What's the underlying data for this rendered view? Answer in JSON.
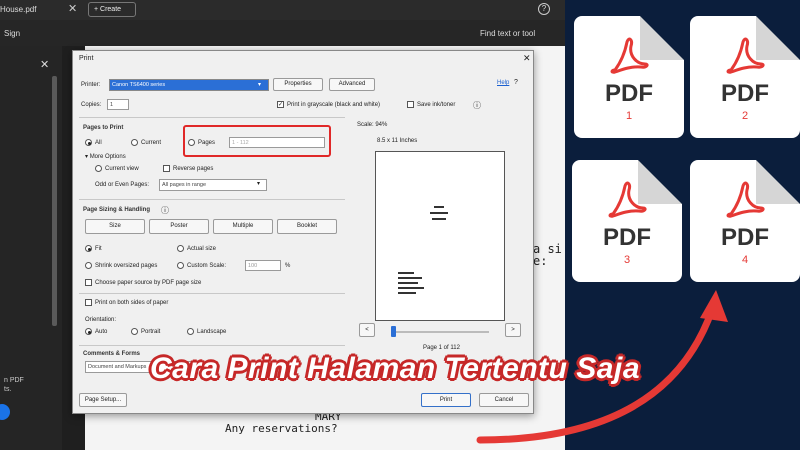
{
  "app": {
    "tab_title": "House.pdf",
    "create_label": "+ Create",
    "sign_label": "Sign",
    "find_label": "Find text or tool",
    "left_panel_text": "n PDF\nts.",
    "screen_text_1": "a si",
    "screen_text_2": "e:",
    "doc_line_1": "MARY",
    "doc_line_2": "Any reservations?"
  },
  "print_dialog": {
    "title": "Print",
    "printer_label": "Printer:",
    "printer_value": "Canon TS6400 series",
    "properties_button": "Properties",
    "advanced_button": "Advanced",
    "help_link": "Help",
    "copies_label": "Copies:",
    "copies_value": "1",
    "grayscale_label": "Print in grayscale (black and white)",
    "grayscale_checked": true,
    "save_ink_label": "Save ink/toner",
    "pages_to_print_title": "Pages to Print",
    "all_label": "All",
    "current_label": "Current",
    "pages_label": "Pages",
    "pages_placeholder": "1 - 112",
    "more_options": "More Options",
    "current_view": "Current view",
    "reverse_pages": "Reverse pages",
    "odd_even_label": "Odd or Even Pages:",
    "odd_even_value": "All pages in range",
    "sizing_title": "Page Sizing & Handling",
    "size_button": "Size",
    "poster_button": "Poster",
    "multiple_button": "Multiple",
    "booklet_button": "Booklet",
    "fit_label": "Fit",
    "actual_size_label": "Actual size",
    "shrink_label": "Shrink oversized pages",
    "custom_scale_label": "Custom Scale:",
    "custom_scale_value": "100",
    "percent": "%",
    "paper_source_label": "Choose paper source by PDF page size",
    "both_sides_label": "Print on both sides of paper",
    "orientation_label": "Orientation:",
    "auto_label": "Auto",
    "portrait_label": "Portrait",
    "landscape_label": "Landscape",
    "comments_title": "Comments & Forms",
    "comments_value": "Document and Markups",
    "scale_label": "Scale: 94%",
    "paper_size": "8.5 x 11 Inches",
    "page_indicator": "Page 1 of 112",
    "page_setup_button": "Page Setup...",
    "print_button": "Print",
    "cancel_button": "Cancel",
    "prev_symbol": "<",
    "next_symbol": ">"
  },
  "pdf_icons": [
    {
      "label": "PDF",
      "number": "1"
    },
    {
      "label": "PDF",
      "number": "2"
    },
    {
      "label": "PDF",
      "number": "3"
    },
    {
      "label": "PDF",
      "number": "4"
    }
  ],
  "caption": "Cara Print Halaman Tertentu Saja",
  "colors": {
    "background": "#0b1e3c",
    "accent_red": "#e53935",
    "caption_stroke": "#c62828",
    "printer_highlight": "#2b6fd6"
  }
}
